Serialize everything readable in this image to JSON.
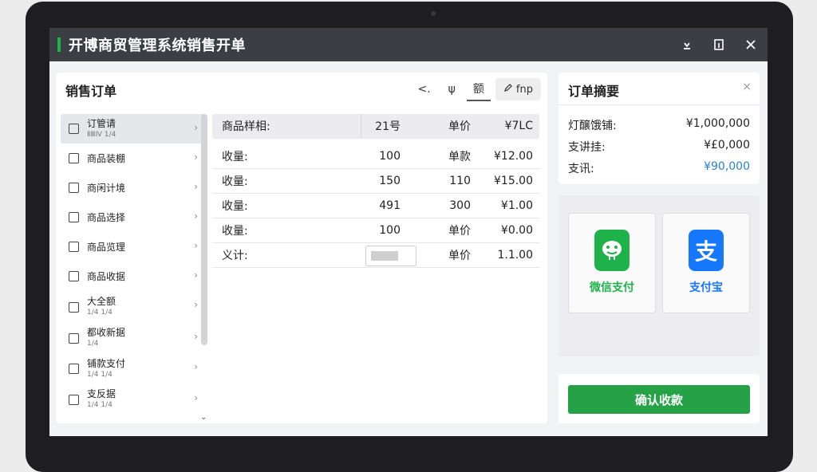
{
  "window": {
    "title": "开博商贸管理系统销售开单",
    "controls": {
      "pin": "⇣",
      "restore": "⧉",
      "close": "✕"
    }
  },
  "left_panel": {
    "title": "销售订单",
    "tools": [
      "<.",
      "ψ",
      "额"
    ],
    "tool_button": "fnp"
  },
  "categories": [
    {
      "label": "订管请",
      "sub": "ⅡⅢⅣ 1/4"
    },
    {
      "label": "商品装棚",
      "sub": ""
    },
    {
      "label": "商闲计境",
      "sub": ""
    },
    {
      "label": "商品选择",
      "sub": ""
    },
    {
      "label": "商品览理",
      "sub": ""
    },
    {
      "label": "商品收据",
      "sub": ""
    },
    {
      "label": "大全额",
      "sub": "1/4 1/4"
    },
    {
      "label": "都收新据",
      "sub": "1/4"
    },
    {
      "label": "铺款支付",
      "sub": "1/4 1/4"
    },
    {
      "label": "支反据",
      "sub": "1/4 1/4"
    }
  ],
  "detail_table": {
    "header": [
      "商品样相:",
      "21号",
      "单价",
      "¥7LC"
    ],
    "rows": [
      [
        "收量:",
        "100",
        "单款",
        "¥12.00"
      ],
      [
        "收量:",
        "150",
        "110",
        "¥15.00"
      ],
      [
        "收量:",
        "491",
        "300",
        "¥1.00"
      ],
      [
        "收量:",
        "100",
        "单价",
        "¥0.00"
      ]
    ],
    "total_row": {
      "label": "义计:",
      "qty": "",
      "price": "单价",
      "amount": "1.1.00"
    }
  },
  "summary": {
    "title": "订单摘要",
    "close": "×",
    "rows": [
      {
        "label": "灯醸饿铺:",
        "value": "¥1,000,000"
      },
      {
        "label": "支讲挂:",
        "value": "¥£0,000"
      },
      {
        "label": "支讯:",
        "value": "¥90,000"
      }
    ],
    "highlight_color": "#2a7fd4"
  },
  "payments": [
    {
      "label": "微信支付",
      "color": "#1fb24a",
      "icon": "wechat-pay-icon"
    },
    {
      "label": "支付宝",
      "color": "#1677ff",
      "icon": "alipay-icon",
      "glyph": "支"
    }
  ],
  "confirm": {
    "label": "确认收款",
    "color": "#25a246"
  },
  "colors": {
    "accent": "#1fb24a",
    "titlebar": "#3b3f44"
  }
}
